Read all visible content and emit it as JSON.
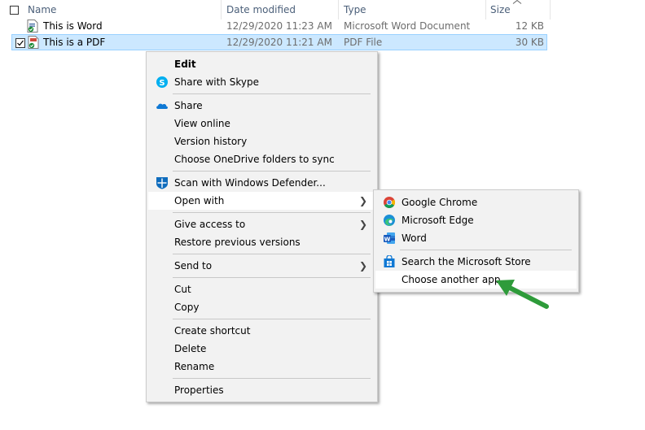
{
  "columns": {
    "name": "Name",
    "date": "Date modified",
    "type": "Type",
    "size": "Size"
  },
  "files": [
    {
      "name": "This is Word",
      "date": "12/29/2020 11:23 AM",
      "type": "Microsoft Word Document",
      "size": "12 KB"
    },
    {
      "name": "This is a PDF",
      "date": "12/29/2020 11:21 AM",
      "type": "PDF File",
      "size": "30 KB"
    }
  ],
  "context_menu": {
    "edit": "Edit",
    "share_skype": "Share with Skype",
    "share": "Share",
    "view_online": "View online",
    "version_history": "Version history",
    "choose_onedrive": "Choose OneDrive folders to sync",
    "scan_defender": "Scan with Windows Defender...",
    "open_with": "Open with",
    "give_access": "Give access to",
    "restore_versions": "Restore previous versions",
    "send_to": "Send to",
    "cut": "Cut",
    "copy": "Copy",
    "create_shortcut": "Create shortcut",
    "delete": "Delete",
    "rename": "Rename",
    "properties": "Properties"
  },
  "open_with_menu": {
    "chrome": "Google Chrome",
    "edge": "Microsoft Edge",
    "word": "Word",
    "store": "Search the Microsoft Store",
    "another": "Choose another app"
  },
  "colors": {
    "selection": "#cce8ff",
    "menu_bg": "#f2f2f2",
    "annotation_arrow": "#2e9b3a"
  }
}
